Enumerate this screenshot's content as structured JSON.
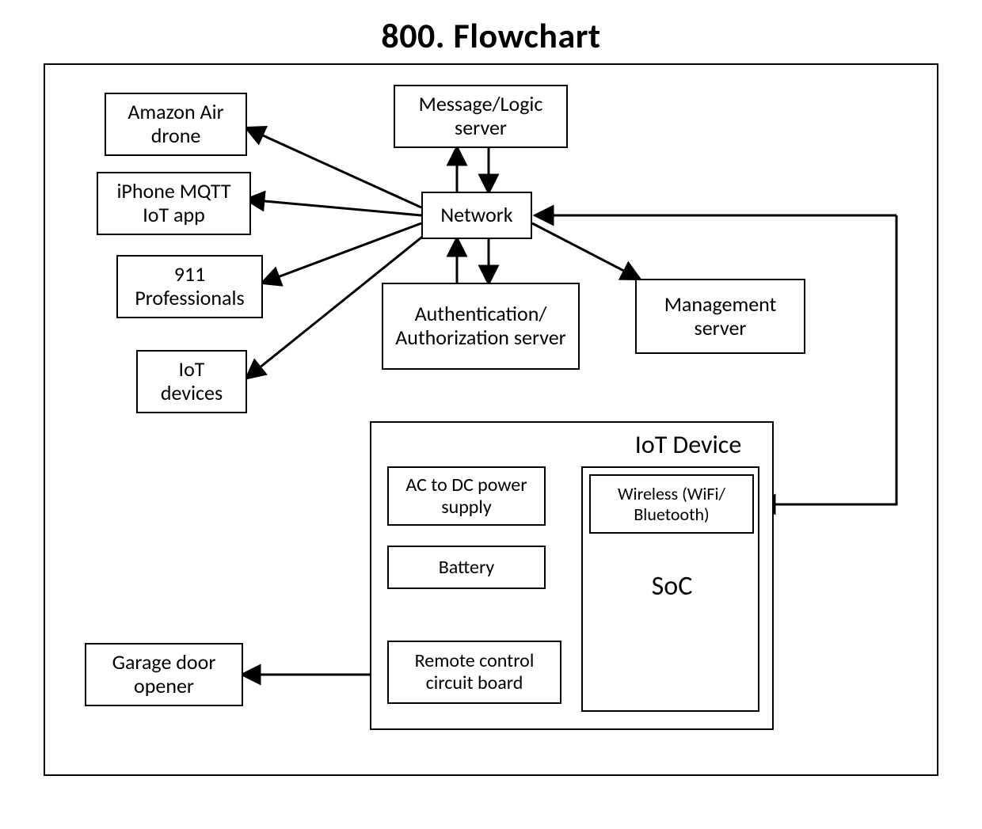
{
  "title": "800. Flowchart",
  "nodes": {
    "amazon_drone": "Amazon Air drone",
    "iphone_mqtt": "iPhone MQTT IoT app",
    "professionals": "911 Professionals",
    "iot_devices": "IoT devices",
    "msg_logic": "Message/Logic server",
    "network": "Network",
    "auth": "Authentication/ Authorization server",
    "mgmt": "Management server",
    "garage": "Garage door opener",
    "iot_device_label": "IoT Device",
    "acdc": "AC to DC power supply",
    "battery": "Battery",
    "remote": "Remote control circuit board",
    "wireless": "Wireless (WiFi/ Bluetooth)",
    "soc": "SoC"
  }
}
